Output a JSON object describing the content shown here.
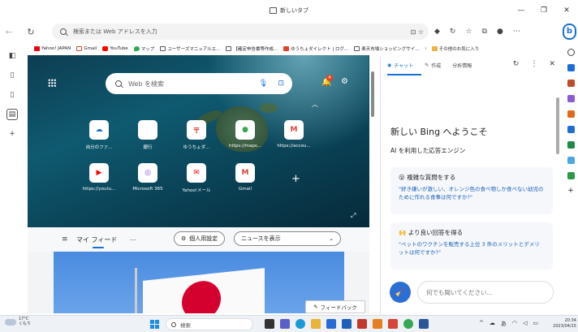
{
  "window": {
    "title": "新しいタブ"
  },
  "address": {
    "placeholder": "検索または Web アドレスを入力"
  },
  "favorites": [
    {
      "label": "Yahoo! JAPAN"
    },
    {
      "label": "Gmail"
    },
    {
      "label": "YouTube"
    },
    {
      "label": "マップ"
    },
    {
      "label": "ユーザーズマニュアルエ..."
    },
    {
      "label": "【確定申告書等作成..."
    },
    {
      "label": "ゆうちょダイレクト | ログ..."
    },
    {
      "label": "楽天市場ショッピングサイ..."
    },
    {
      "label": "その他のお気に入り"
    }
  ],
  "newtab": {
    "search_placeholder": "Web を検索",
    "notification_count": "4",
    "tiles": [
      {
        "label": "自分のファ...",
        "icon": "cloud-icon",
        "color": "#1b6ed6"
      },
      {
        "label": "銀行",
        "icon": "apple-icon",
        "color": "#444444"
      },
      {
        "label": "ゆうちょダ...",
        "icon": "yucho-icon",
        "color": "#e03a2a"
      },
      {
        "label": "https://maps...",
        "icon": "maps-icon",
        "color": "#34a853"
      },
      {
        "label": "https://accou...",
        "icon": "gmail-icon",
        "color": "#d44638"
      },
      {
        "label": "https://youtu...",
        "icon": "youtube-icon",
        "color": "#ff0000"
      },
      {
        "label": "Microsoft 365",
        "icon": "m365-icon",
        "color": "#7b4fd6"
      },
      {
        "label": "Yahoo!メール",
        "icon": "yahoo-mail-icon",
        "color": "#e60012"
      },
      {
        "label": "Gmail",
        "icon": "gmail-icon",
        "color": "#d44638"
      }
    ],
    "feed_label": "マイ フィード",
    "personalize_label": "個人用設定",
    "news_label": "ニュースを表示",
    "feedback_label": "フィードバック"
  },
  "sidebar": {
    "tabs": [
      "チャット",
      "作成",
      "分析情報"
    ],
    "welcome": "新しい Bing へようこそ",
    "subtitle": "AI を利用した応答エンジン",
    "cards": [
      {
        "emoji": "😮",
        "title": "複雑な質問をする",
        "body": "\"好き嫌いが激しい、オレンジ色の食べ物しか食べない幼児のために作れる食事は何ですか?\""
      },
      {
        "emoji": "🙌",
        "title": "より良い回答を得る",
        "body": "\"ペットのワクチンを販売する上位 3 件のメリットとデメリットは何ですか?\""
      }
    ],
    "chat_placeholder": "何でも聞いてください..."
  },
  "taskbar": {
    "weather_temp": "17°C",
    "weather_text": "くもり",
    "search_label": "検索",
    "time": "20:34",
    "date": "2023/04/15"
  }
}
